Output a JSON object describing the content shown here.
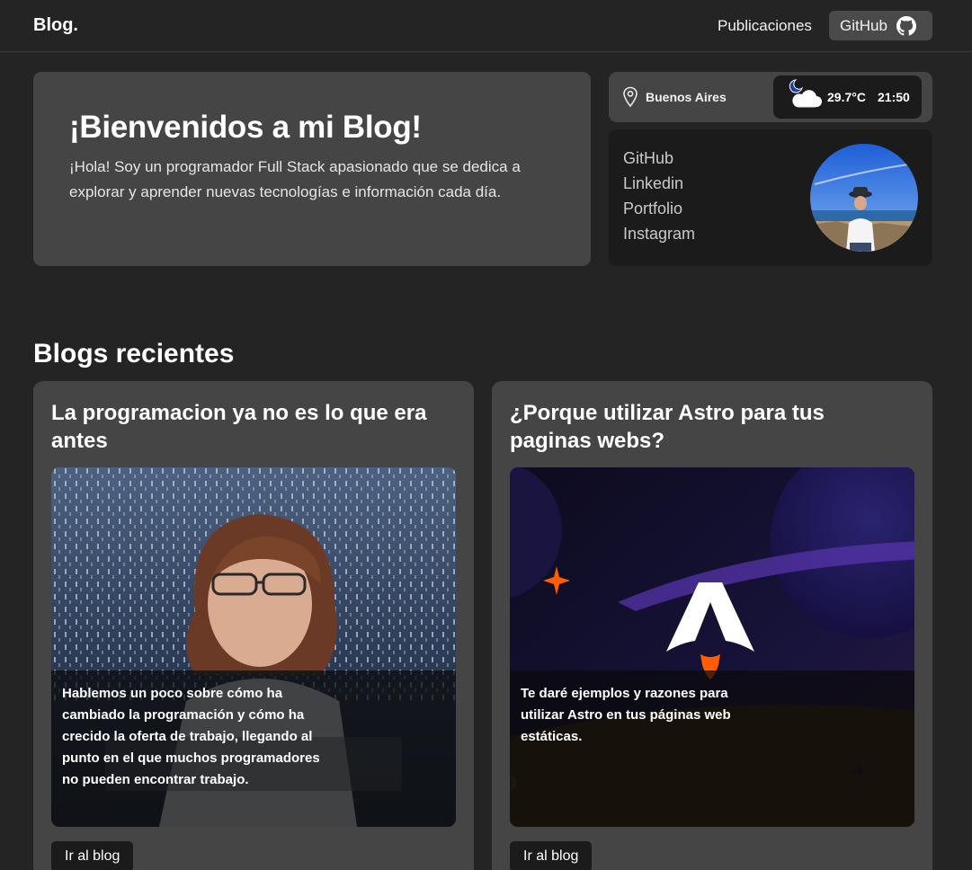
{
  "header": {
    "brand": "Blog.",
    "nav": {
      "publications": "Publicaciones",
      "github": "GitHub"
    }
  },
  "hero": {
    "title": "¡Bienvenidos a mi Blog!",
    "text": "¡Hola! Soy un programador Full Stack apasionado que se dedica a explorar y aprender nuevas tecnologías e información cada día."
  },
  "location": {
    "city": "Buenos Aires",
    "temperature": "29.7°C",
    "time": "21:50",
    "weather_icon": "moon-cloud-icon"
  },
  "social": {
    "links": [
      "GitHub",
      "Linkedin",
      "Portfolio",
      "Instagram"
    ]
  },
  "recent": {
    "title": "Blogs recientes",
    "posts": [
      {
        "title": "La programacion ya no es lo que era antes",
        "excerpt": "Hablemos un poco sobre cómo ha cambiado la programación y cómo ha crecido la oferta de trabajo, llegando al punto en el que muchos programadores no pueden encontrar trabajo.",
        "button": "Ir al blog"
      },
      {
        "title": "¿Porque utilizar Astro para tus paginas webs?",
        "excerpt": "Te daré ejemplos y razones para utilizar Astro en tus páginas web estáticas.",
        "button": "Ir al blog",
        "image_text": "astro"
      }
    ]
  },
  "colors": {
    "background": "#242424",
    "card": "#454545",
    "dark_card": "#1b1b1b",
    "astro_orange": "#ff5d01"
  }
}
